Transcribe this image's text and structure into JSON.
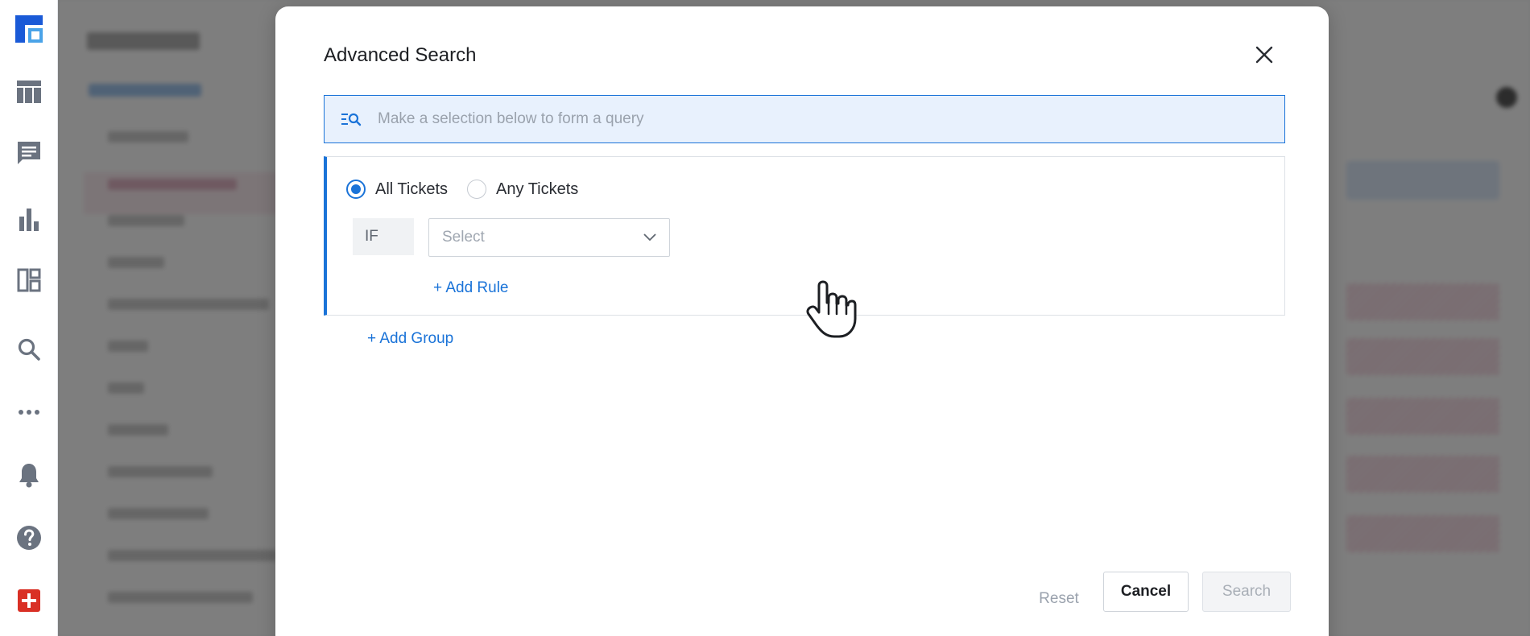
{
  "nav": {
    "items": [
      {
        "icon": "logo-icon"
      },
      {
        "icon": "table-icon"
      },
      {
        "icon": "chat-icon"
      },
      {
        "icon": "bar-chart-icon"
      },
      {
        "icon": "dashboard-icon"
      },
      {
        "icon": "search-icon"
      },
      {
        "icon": "more-icon"
      },
      {
        "icon": "bell-icon"
      },
      {
        "icon": "help-icon"
      },
      {
        "icon": "add-icon"
      }
    ],
    "accent_color": "#1a73d8",
    "add_color": "#d93025"
  },
  "modal": {
    "title": "Advanced Search",
    "query": {
      "placeholder": "Make a selection below to form a query",
      "value": ""
    },
    "group": {
      "match_options": [
        {
          "label": "All Tickets",
          "selected": true
        },
        {
          "label": "Any Tickets",
          "selected": false
        }
      ],
      "rule_prefix": "IF",
      "rule_select_placeholder": "Select",
      "add_rule_label": "+ Add Rule"
    },
    "add_group_label": "+ Add Group",
    "footer": {
      "reset_label": "Reset",
      "cancel_label": "Cancel",
      "search_label": "Search"
    }
  }
}
